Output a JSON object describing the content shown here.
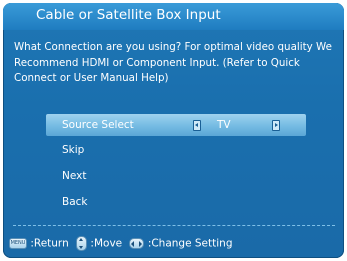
{
  "header": {
    "title": "Cable or Satellite Box Input"
  },
  "description": "What Connection are you using? For optimal video quality We Recommend HDMI or Component Input. (Refer to Quick Connect or User Manual Help)",
  "menu": {
    "items": [
      {
        "label": "Source Select",
        "value": "TV",
        "selected": true
      },
      {
        "label": "Skip"
      },
      {
        "label": "Next"
      },
      {
        "label": "Back"
      }
    ]
  },
  "footer": {
    "menu_key": "MENU",
    "return_label": ":Return",
    "move_label": ":Move",
    "change_label": ":Change Setting"
  },
  "colors": {
    "background": "#1a6fae",
    "title_bar": "#1f7cc0",
    "selection": "#78bde4",
    "text": "#ffffff"
  },
  "icons": {
    "return": "menu-key-icon",
    "move": "up-down-key-icon",
    "change": "left-right-key-icon"
  }
}
